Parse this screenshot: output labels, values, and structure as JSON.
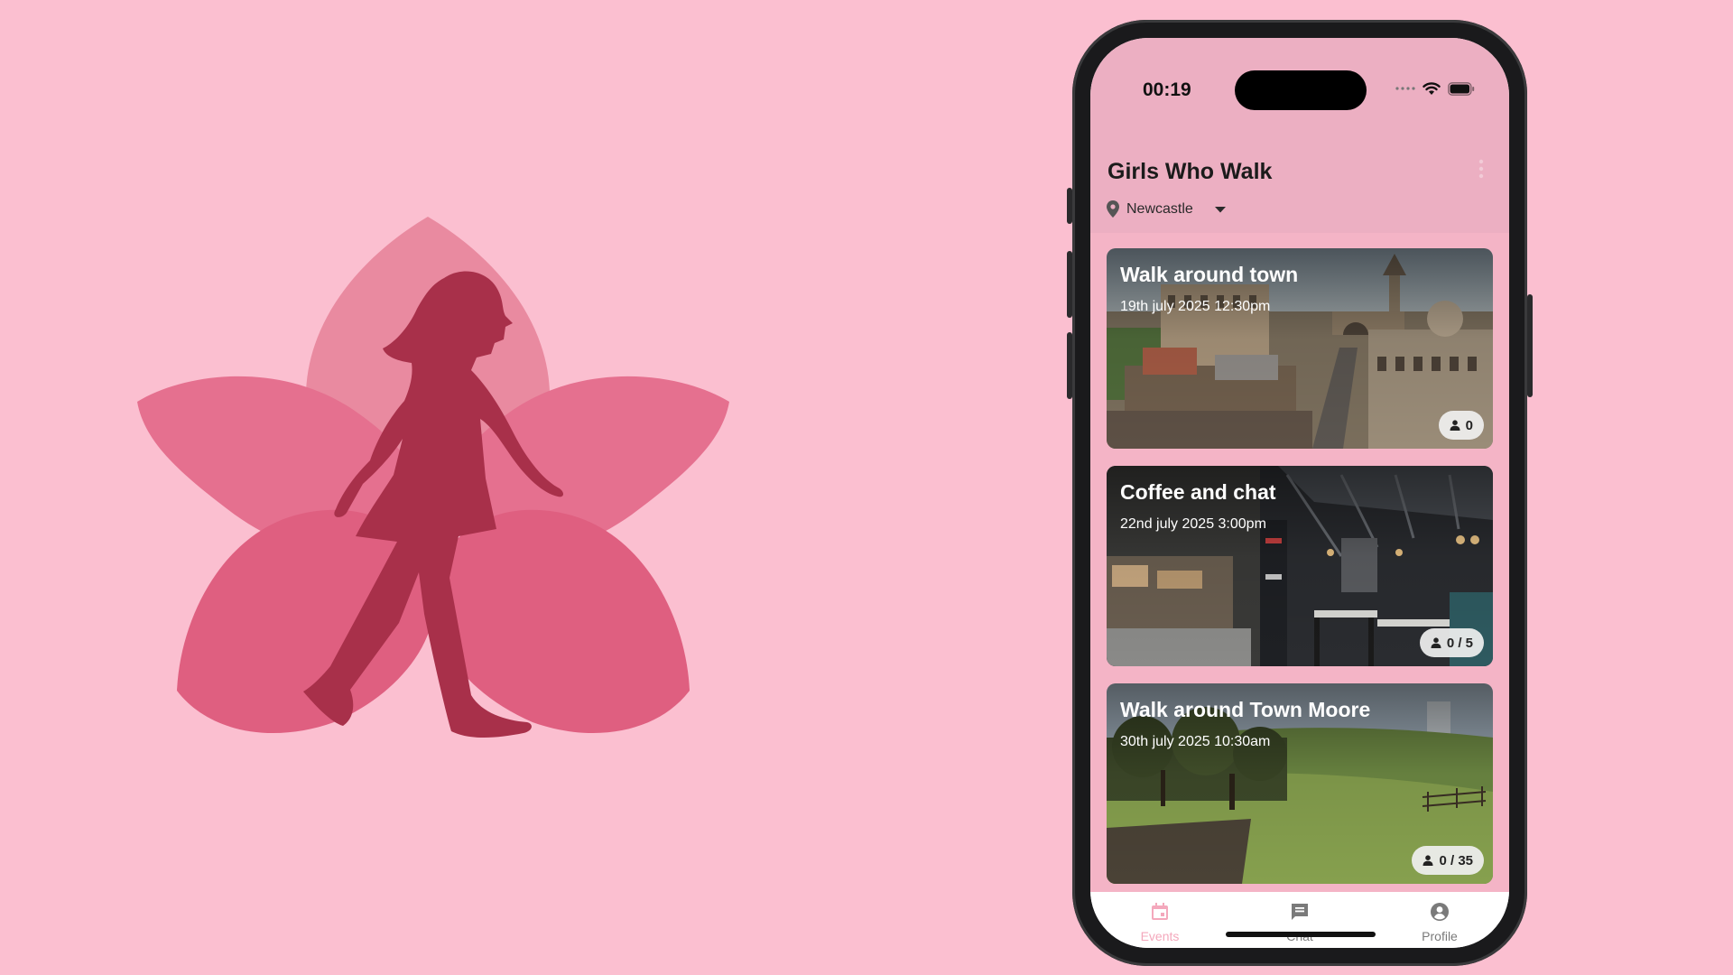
{
  "logo": {
    "petal_colors": [
      "#e98aa0",
      "#e5708f",
      "#df5f80"
    ],
    "figure_color": "#a8304a",
    "icon": "walking-woman-flower-logo"
  },
  "status_bar": {
    "time": "00:19"
  },
  "app": {
    "title": "Girls Who Walk",
    "location": "Newcastle",
    "accent": "#ecafc2"
  },
  "events": [
    {
      "title": "Walk around town",
      "date": "19th july 2025 12:30pm",
      "attendees": "0"
    },
    {
      "title": "Coffee and chat",
      "date": "22nd july 2025 3:00pm",
      "attendees": "0 / 5"
    },
    {
      "title": "Walk around Town Moore",
      "date": "30th july 2025 10:30am",
      "attendees": "0 / 35"
    }
  ],
  "tabs": [
    {
      "label": "Events",
      "icon": "calendar-icon",
      "active": true
    },
    {
      "label": "Chat",
      "icon": "chat-icon",
      "active": false
    },
    {
      "label": "Profile",
      "icon": "profile-icon",
      "active": false
    }
  ]
}
